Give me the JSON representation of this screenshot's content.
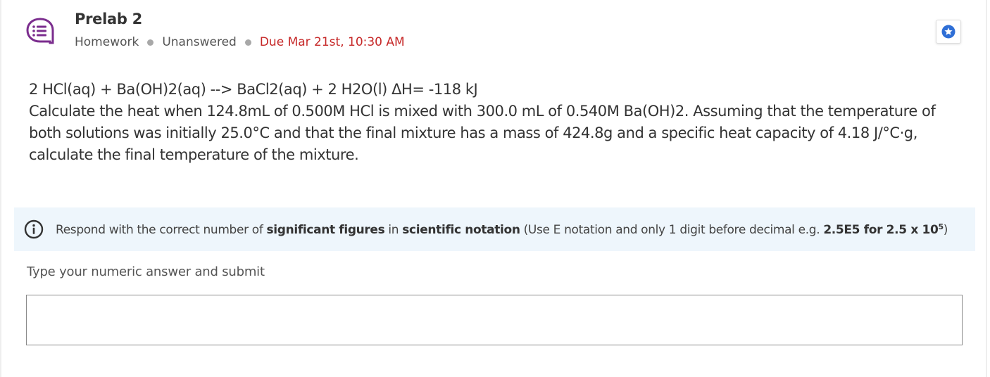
{
  "header": {
    "title": "Prelab 2",
    "type": "Homework",
    "status": "Unanswered",
    "due": "Due Mar 21st, 10:30 AM",
    "icon": "question-list-icon",
    "bookmark_icon": "star-icon"
  },
  "question": {
    "equation": "2 HCl(aq) + Ba(OH)2(aq) --> BaCl2(aq) + 2 H2O(l) ΔH= -118 kJ",
    "text": "Calculate the heat when 124.8mL of 0.500M HCl is mixed with 300.0 mL of 0.540M Ba(OH)2. Assuming that the temperature of both solutions was initially 25.0°C and that the final mixture has a mass of 424.8g and a specific heat capacity of 4.18 J/°C·g, calculate the final temperature of the mixture."
  },
  "info": {
    "icon": "info-icon",
    "prefix": "Respond with the correct number of ",
    "bold1": "significant figures",
    "mid": " in ",
    "bold2": "scientific notation",
    "suffix": " (Use E notation and only 1 digit before decimal e.g. ",
    "bold3": "2.5E5 for 2.5 x 10",
    "exponent": "5",
    "close": ")"
  },
  "answer": {
    "label": "Type your numeric answer and submit",
    "value": "",
    "placeholder": ""
  },
  "colors": {
    "accent_purple": "#7b2d8e",
    "due_red": "#c62828",
    "star_blue": "#2f6fd6",
    "banner_bg": "#eef6fc"
  }
}
